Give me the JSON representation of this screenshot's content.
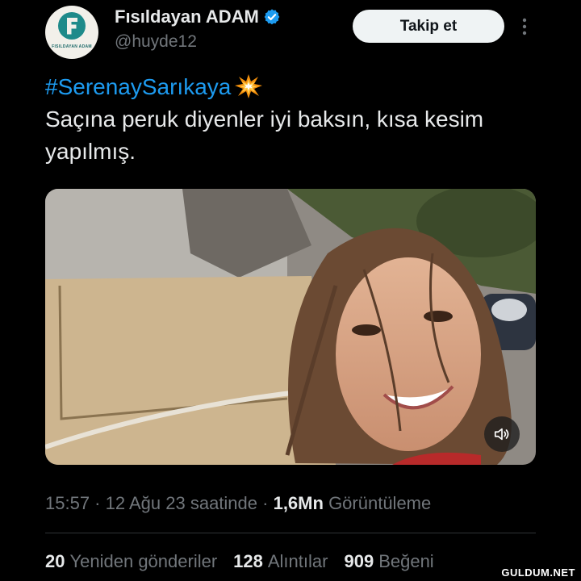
{
  "header": {
    "display_name": "Fısıldayan ADAM",
    "handle": "@huyde12",
    "follow_label": "Takip et",
    "avatar_logo_text": "FISILDAYAN ADAM"
  },
  "tweet": {
    "hashtag": "#SerenaySarıkaya",
    "emoji": "collision-icon",
    "text": "Saçına peruk diyenler iyi baksın, kısa kesim yapılmış."
  },
  "media": {
    "type": "video",
    "sound_icon": "volume-icon"
  },
  "meta": {
    "time": "15:57",
    "separator": " · ",
    "date": "12 Ağu 23 saatinde",
    "views_count": "1,6Mn",
    "views_label": "Görüntüleme"
  },
  "stats": {
    "retweets_count": "20",
    "retweets_label": "Yeniden gönderiler",
    "quotes_count": "128",
    "quotes_label": "Alıntılar",
    "likes_count": "909",
    "likes_label": "Beğeni"
  },
  "watermark": "GULDUM.NET",
  "colors": {
    "background": "#000000",
    "text": "#e7e9ea",
    "secondary": "#71767b",
    "accent": "#1d9bf0",
    "button_bg": "#eff3f4"
  }
}
